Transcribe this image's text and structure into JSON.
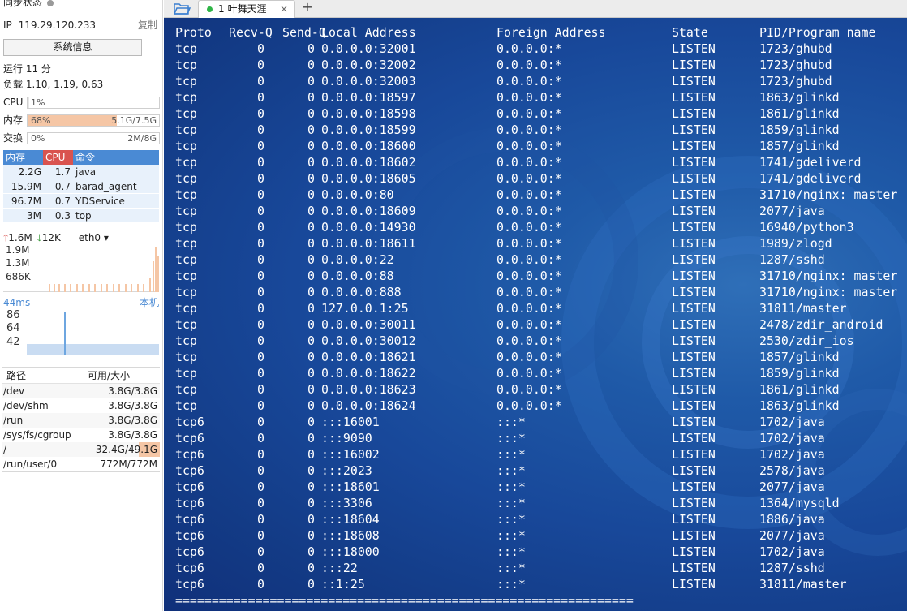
{
  "sidebar": {
    "sync_status": "同步状态",
    "ip_label": "IP",
    "ip": "119.29.120.233",
    "copy": "复制",
    "sysinfo_button": "系统信息",
    "uptime": "运行 11 分",
    "load": "负载 1.10, 1.19, 0.63",
    "cpu": {
      "label": "CPU",
      "value": "1%",
      "fraction": 0.01,
      "right": ""
    },
    "memory": {
      "label": "内存",
      "value": "68%",
      "fraction": 0.68,
      "right": "5.1G/7.5G"
    },
    "swap": {
      "label": "交换",
      "value": "0%",
      "fraction": 0.0,
      "right": "2M/8G"
    },
    "process_headers": {
      "mem": "内存",
      "cpu": "CPU",
      "cmd": "命令"
    },
    "processes": [
      {
        "mem": "2.2G",
        "cpu": "1.7",
        "cmd": "java"
      },
      {
        "mem": "15.9M",
        "cpu": "0.7",
        "cmd": "barad_agent"
      },
      {
        "mem": "96.7M",
        "cpu": "0.7",
        "cmd": "YDService"
      },
      {
        "mem": "3M",
        "cpu": "0.3",
        "cmd": "top"
      }
    ],
    "net": {
      "up": "1.6M",
      "down": "12K",
      "iface": "eth0",
      "labels": [
        "1.9M",
        "1.3M",
        "686K"
      ]
    },
    "latency": {
      "ms": "44ms",
      "local": "本机",
      "labels": [
        "86",
        "64",
        "42"
      ]
    },
    "disk_headers": {
      "path": "路径",
      "size": "可用/大小"
    },
    "disks": [
      {
        "path": "/dev",
        "size": "3.8G/3.8G"
      },
      {
        "path": "/dev/shm",
        "size": "3.8G/3.8G"
      },
      {
        "path": "/run",
        "size": "3.8G/3.8G"
      },
      {
        "path": "/sys/fs/cgroup",
        "size": "3.8G/3.8G"
      },
      {
        "path": "/",
        "size": "32.4G/49.1G"
      },
      {
        "path": "/run/user/0",
        "size": "772M/772M"
      }
    ]
  },
  "tabs": [
    {
      "label": "1 叶舞天涯",
      "close": "×"
    }
  ],
  "add_tab": "+",
  "colors": {
    "accent": "#4a8ad4",
    "cpu_header": "#d9534f",
    "mem_fill": "#f5c6a5",
    "terminal_bg": "#1a4d9e",
    "status_dot": "#2fb547"
  },
  "terminal": {
    "headers": [
      "Proto",
      "Recv-Q",
      "Send-Q",
      "Local Address",
      "Foreign Address",
      "State",
      "PID/Program name"
    ],
    "rows": [
      [
        "tcp",
        "0",
        "0",
        "0.0.0.0:32001",
        "0.0.0.0:*",
        "LISTEN",
        "1723/ghubd"
      ],
      [
        "tcp",
        "0",
        "0",
        "0.0.0.0:32002",
        "0.0.0.0:*",
        "LISTEN",
        "1723/ghubd"
      ],
      [
        "tcp",
        "0",
        "0",
        "0.0.0.0:32003",
        "0.0.0.0:*",
        "LISTEN",
        "1723/ghubd"
      ],
      [
        "tcp",
        "0",
        "0",
        "0.0.0.0:18597",
        "0.0.0.0:*",
        "LISTEN",
        "1863/glinkd"
      ],
      [
        "tcp",
        "0",
        "0",
        "0.0.0.0:18598",
        "0.0.0.0:*",
        "LISTEN",
        "1861/glinkd"
      ],
      [
        "tcp",
        "0",
        "0",
        "0.0.0.0:18599",
        "0.0.0.0:*",
        "LISTEN",
        "1859/glinkd"
      ],
      [
        "tcp",
        "0",
        "0",
        "0.0.0.0:18600",
        "0.0.0.0:*",
        "LISTEN",
        "1857/glinkd"
      ],
      [
        "tcp",
        "0",
        "0",
        "0.0.0.0:18602",
        "0.0.0.0:*",
        "LISTEN",
        "1741/gdeliverd"
      ],
      [
        "tcp",
        "0",
        "0",
        "0.0.0.0:18605",
        "0.0.0.0:*",
        "LISTEN",
        "1741/gdeliverd"
      ],
      [
        "tcp",
        "0",
        "0",
        "0.0.0.0:80",
        "0.0.0.0:*",
        "LISTEN",
        "31710/nginx: master"
      ],
      [
        "tcp",
        "0",
        "0",
        "0.0.0.0:18609",
        "0.0.0.0:*",
        "LISTEN",
        "2077/java"
      ],
      [
        "tcp",
        "0",
        "0",
        "0.0.0.0:14930",
        "0.0.0.0:*",
        "LISTEN",
        "16940/python3"
      ],
      [
        "tcp",
        "0",
        "0",
        "0.0.0.0:18611",
        "0.0.0.0:*",
        "LISTEN",
        "1989/zlogd"
      ],
      [
        "tcp",
        "0",
        "0",
        "0.0.0.0:22",
        "0.0.0.0:*",
        "LISTEN",
        "1287/sshd"
      ],
      [
        "tcp",
        "0",
        "0",
        "0.0.0.0:88",
        "0.0.0.0:*",
        "LISTEN",
        "31710/nginx: master"
      ],
      [
        "tcp",
        "0",
        "0",
        "0.0.0.0:888",
        "0.0.0.0:*",
        "LISTEN",
        "31710/nginx: master"
      ],
      [
        "tcp",
        "0",
        "0",
        "127.0.0.1:25",
        "0.0.0.0:*",
        "LISTEN",
        "31811/master"
      ],
      [
        "tcp",
        "0",
        "0",
        "0.0.0.0:30011",
        "0.0.0.0:*",
        "LISTEN",
        "2478/zdir_android"
      ],
      [
        "tcp",
        "0",
        "0",
        "0.0.0.0:30012",
        "0.0.0.0:*",
        "LISTEN",
        "2530/zdir_ios"
      ],
      [
        "tcp",
        "0",
        "0",
        "0.0.0.0:18621",
        "0.0.0.0:*",
        "LISTEN",
        "1857/glinkd"
      ],
      [
        "tcp",
        "0",
        "0",
        "0.0.0.0:18622",
        "0.0.0.0:*",
        "LISTEN",
        "1859/glinkd"
      ],
      [
        "tcp",
        "0",
        "0",
        "0.0.0.0:18623",
        "0.0.0.0:*",
        "LISTEN",
        "1861/glinkd"
      ],
      [
        "tcp",
        "0",
        "0",
        "0.0.0.0:18624",
        "0.0.0.0:*",
        "LISTEN",
        "1863/glinkd"
      ],
      [
        "tcp6",
        "0",
        "0",
        ":::16001",
        ":::*",
        "LISTEN",
        "1702/java"
      ],
      [
        "tcp6",
        "0",
        "0",
        ":::9090",
        ":::*",
        "LISTEN",
        "1702/java"
      ],
      [
        "tcp6",
        "0",
        "0",
        ":::16002",
        ":::*",
        "LISTEN",
        "1702/java"
      ],
      [
        "tcp6",
        "0",
        "0",
        ":::2023",
        ":::*",
        "LISTEN",
        "2578/java"
      ],
      [
        "tcp6",
        "0",
        "0",
        ":::18601",
        ":::*",
        "LISTEN",
        "2077/java"
      ],
      [
        "tcp6",
        "0",
        "0",
        ":::3306",
        ":::*",
        "LISTEN",
        "1364/mysqld"
      ],
      [
        "tcp6",
        "0",
        "0",
        ":::18604",
        ":::*",
        "LISTEN",
        "1886/java"
      ],
      [
        "tcp6",
        "0",
        "0",
        ":::18608",
        ":::*",
        "LISTEN",
        "2077/java"
      ],
      [
        "tcp6",
        "0",
        "0",
        ":::18000",
        ":::*",
        "LISTEN",
        "1702/java"
      ],
      [
        "tcp6",
        "0",
        "0",
        ":::22",
        ":::*",
        "LISTEN",
        "1287/sshd"
      ],
      [
        "tcp6",
        "0",
        "0",
        "::1:25",
        ":::*",
        "LISTEN",
        "31811/master"
      ]
    ],
    "separator": "==============================================================="
  }
}
